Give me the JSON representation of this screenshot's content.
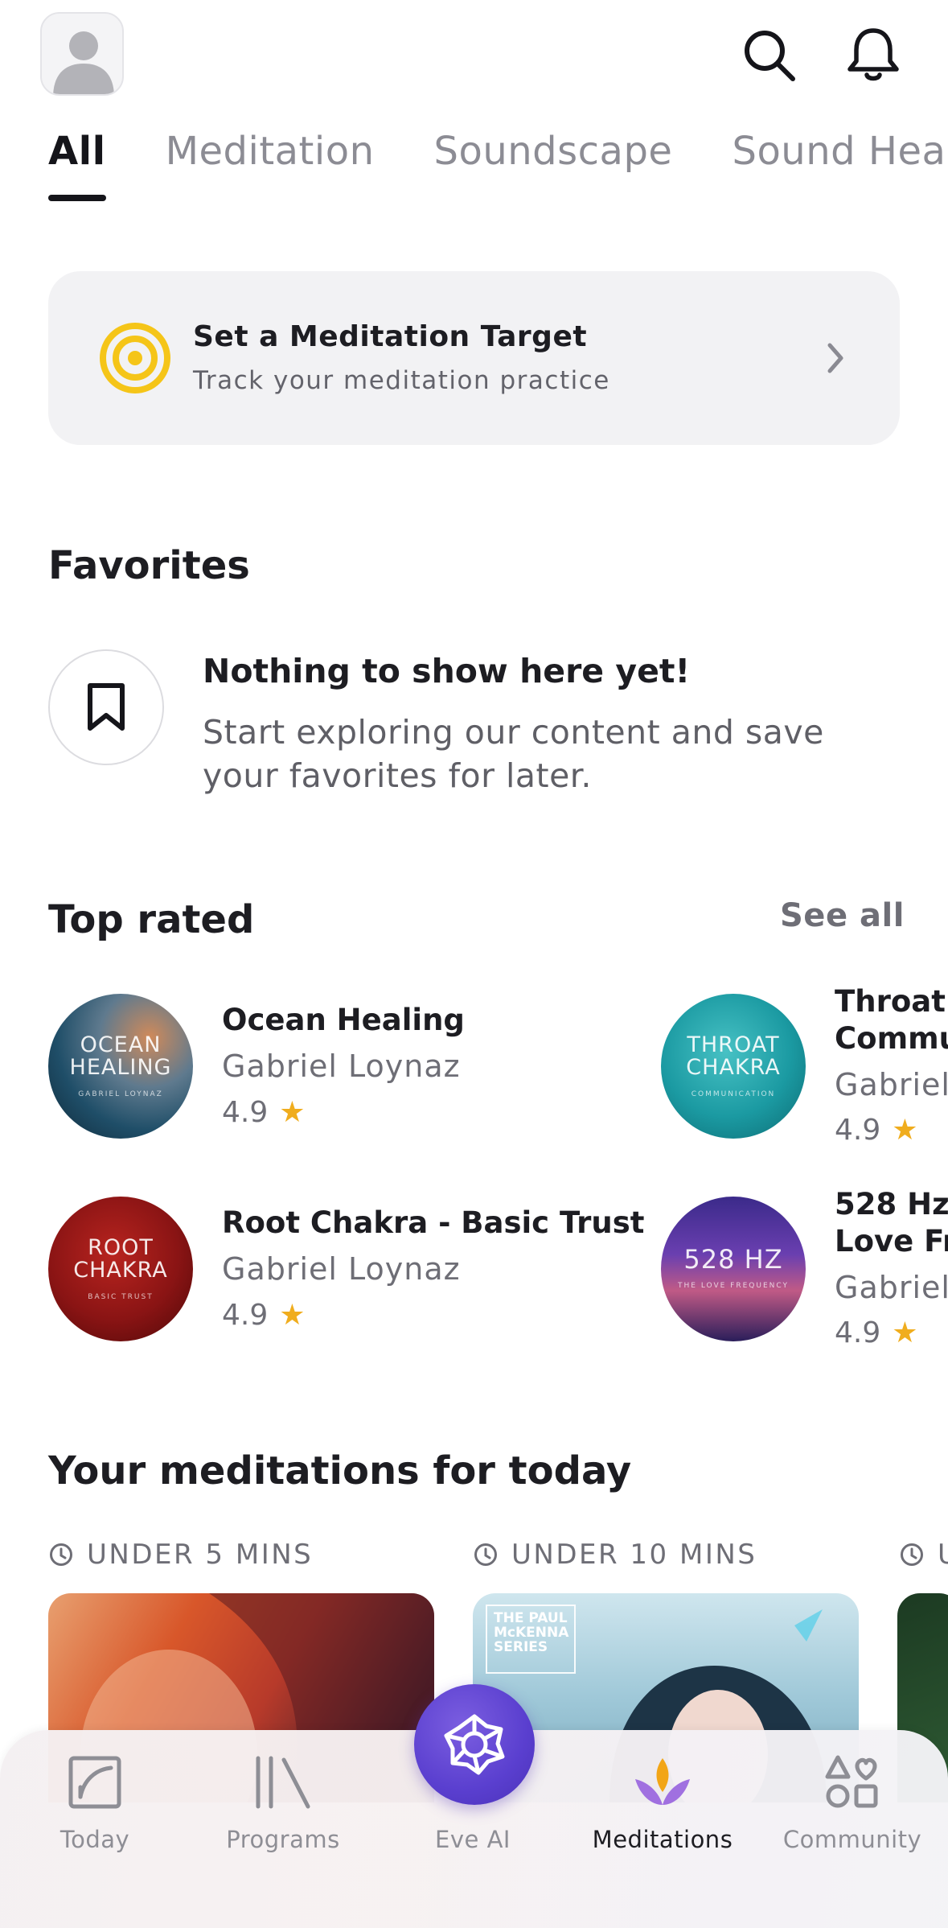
{
  "header": {
    "avatar_icon": "user-avatar-icon",
    "search_icon": "search-icon",
    "notifications_icon": "bell-icon"
  },
  "tabs": [
    {
      "label": "All",
      "active": true
    },
    {
      "label": "Meditation",
      "active": false
    },
    {
      "label": "Soundscape",
      "active": false
    },
    {
      "label": "Sound Hea",
      "active": false
    }
  ],
  "target_card": {
    "title": "Set a Meditation Target",
    "subtitle": "Track your meditation practice",
    "icon": "target-icon",
    "accent": "#f5c518"
  },
  "favorites": {
    "heading": "Favorites",
    "empty_title": "Nothing to show here yet!",
    "empty_message": "Start exploring our content and save your favorites for later."
  },
  "top_rated": {
    "heading": "Top rated",
    "see_all": "See all",
    "items": [
      {
        "title": "Ocean Healing",
        "author": "Gabriel Loynaz",
        "rating": "4.9",
        "cover_big": "OCEAN HEALING",
        "cover_small": "GABRIEL LOYNAZ"
      },
      {
        "title": "Root Chakra - Basic Trust",
        "author": "Gabriel Loynaz",
        "rating": "4.9",
        "cover_big": "ROOT CHAKRA",
        "cover_small": "BASIC TRUST"
      },
      {
        "title_line1": "Throat (",
        "title_line2": "Commu",
        "author": "Gabriel",
        "rating": "4.9",
        "cover_big": "THROAT CHAKRA",
        "cover_small": "COMMUNICATION"
      },
      {
        "title_line1": "528 Hz",
        "title_line2": "Love Fre",
        "author": "Gabriel",
        "rating": "4.9",
        "cover_big": "528 HZ",
        "cover_small": "THE LOVE FREQUENCY"
      }
    ]
  },
  "today": {
    "heading": "Your meditations for today",
    "groups": [
      {
        "label": "UNDER 5 MINS"
      },
      {
        "label": "UNDER 10 MINS",
        "badge": "THE PAUL McKENNA SERIES"
      },
      {
        "label": "U"
      }
    ]
  },
  "bottom_nav": [
    {
      "label": "Today",
      "icon": "today-icon"
    },
    {
      "label": "Programs",
      "icon": "programs-icon"
    },
    {
      "label": "Eve AI",
      "icon": "eve-ai-icon"
    },
    {
      "label": "Meditations",
      "icon": "lotus-icon",
      "active": true
    },
    {
      "label": "Community",
      "icon": "community-icon"
    }
  ],
  "colors": {
    "star": "#f0ad1e",
    "eve_purple": "#5a3fcf",
    "lotus_orange": "#f2a516",
    "lotus_purple": "#a070e0"
  }
}
